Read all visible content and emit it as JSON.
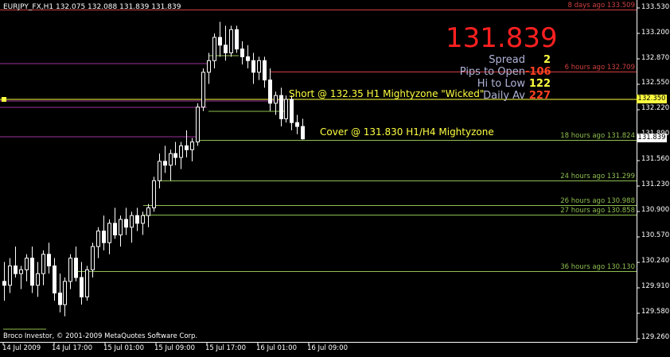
{
  "chart": {
    "symbol_header": "EURJPY_FX,H1  132.075 132.088 131.839 131.839",
    "big_price": "131.839",
    "copyright": "Broco Investor, © 2001-2009 MetaQuotes Software Corp.",
    "colors": {
      "background": "#000000",
      "candle": "#ffffff",
      "big_price": "#ff2020",
      "yellow": "#ffff40",
      "green_line": "#8fbf50",
      "red_line": "#d04040",
      "purple_line": "#a030a0"
    }
  },
  "stats": [
    {
      "label": "Spread",
      "value": "2",
      "color": "#ffff40"
    },
    {
      "label": "Pips to Open",
      "value": "-106",
      "color": "#ff4020"
    },
    {
      "label": "Hi to Low",
      "value": "122",
      "color": "#ffff40"
    },
    {
      "label": "Daily Av",
      "value": "227",
      "color": "#ff4020"
    }
  ],
  "annotations": {
    "short_text": "Short @ 132.35 H1 Mightyzone \"Wicked\"",
    "cover_text": "Cover @ 131.830 H1/H4 Mightyzone"
  },
  "y_axis": {
    "labels": [
      "133.530",
      "133.200",
      "132.870",
      "132.550",
      "132.220",
      "131.890",
      "131.560",
      "131.230",
      "130.900",
      "130.570",
      "130.240",
      "129.910",
      "129.580",
      "129.260"
    ]
  },
  "price_tags": [
    {
      "value": "132.350",
      "bg": "#ffff40",
      "color": "#000000"
    },
    {
      "value": "131.839",
      "bg": "#ffffff",
      "color": "#000000"
    }
  ],
  "x_axis": {
    "labels": [
      "14 Jul 2009",
      "14 Jul 17:00",
      "15 Jul 01:00",
      "15 Jul 09:00",
      "15 Jul 17:00",
      "16 Jul 01:00",
      "16 Jul 09:00"
    ]
  },
  "level_lines": [
    {
      "label": "8 days ago 133.509",
      "price": 133.509,
      "color": "#d04040"
    },
    {
      "label": "6 hours ago 132.709",
      "price": 132.709,
      "color": "#d04040"
    },
    {
      "label": "18 hours ago 131.824",
      "price": 131.824,
      "color": "#8fbf50"
    },
    {
      "label": "24 hours ago 131.299",
      "price": 131.299,
      "color": "#8fbf50"
    },
    {
      "label": "26 hours ago 130.988",
      "price": 130.988,
      "color": "#8fbf50"
    },
    {
      "label": "27 hours ago 130.858",
      "price": 130.858,
      "color": "#8fbf50"
    },
    {
      "label": "36 hours ago 130.130",
      "price": 130.13,
      "color": "#8fbf50"
    }
  ],
  "candles": [
    [
      130.0,
      130.25,
      129.75,
      129.95
    ],
    [
      129.95,
      130.3,
      129.85,
      130.2
    ],
    [
      130.2,
      130.45,
      130.05,
      130.1
    ],
    [
      130.1,
      130.2,
      129.9,
      130.15
    ],
    [
      130.15,
      130.35,
      130.0,
      130.3
    ],
    [
      130.3,
      130.45,
      129.85,
      129.95
    ],
    [
      129.95,
      130.25,
      129.8,
      130.1
    ],
    [
      130.1,
      130.4,
      129.95,
      130.35
    ],
    [
      130.35,
      130.5,
      130.1,
      130.2
    ],
    [
      130.2,
      130.3,
      129.75,
      129.85
    ],
    [
      129.85,
      130.1,
      129.6,
      129.7
    ],
    [
      129.7,
      130.05,
      129.55,
      130.0
    ],
    [
      130.0,
      130.35,
      129.9,
      130.3
    ],
    [
      130.3,
      130.45,
      130.0,
      130.05
    ],
    [
      130.05,
      130.25,
      129.7,
      129.8
    ],
    [
      129.8,
      130.2,
      129.75,
      130.15
    ],
    [
      130.15,
      130.5,
      130.05,
      130.45
    ],
    [
      130.45,
      130.7,
      130.3,
      130.65
    ],
    [
      130.65,
      130.85,
      130.4,
      130.5
    ],
    [
      130.5,
      130.8,
      130.35,
      130.75
    ],
    [
      130.75,
      130.95,
      130.55,
      130.6
    ],
    [
      130.6,
      130.85,
      130.45,
      130.8
    ],
    [
      130.8,
      130.95,
      130.6,
      130.7
    ],
    [
      130.7,
      130.9,
      130.5,
      130.85
    ],
    [
      130.85,
      130.95,
      130.65,
      130.75
    ],
    [
      130.75,
      130.9,
      130.6,
      130.85
    ],
    [
      130.85,
      131.0,
      130.7,
      130.95
    ],
    [
      130.95,
      131.35,
      130.9,
      131.3
    ],
    [
      131.3,
      131.65,
      131.2,
      131.55
    ],
    [
      131.55,
      131.75,
      131.4,
      131.5
    ],
    [
      131.5,
      131.7,
      131.3,
      131.65
    ],
    [
      131.65,
      131.8,
      131.5,
      131.6
    ],
    [
      131.6,
      131.8,
      131.45,
      131.75
    ],
    [
      131.75,
      131.95,
      131.6,
      131.7
    ],
    [
      131.7,
      131.85,
      131.55,
      131.8
    ],
    [
      131.8,
      132.3,
      131.75,
      132.25
    ],
    [
      132.25,
      132.75,
      132.2,
      132.7
    ],
    [
      132.7,
      132.95,
      132.55,
      132.85
    ],
    [
      132.85,
      133.2,
      132.75,
      133.15
    ],
    [
      133.15,
      133.35,
      132.9,
      133.05
    ],
    [
      133.05,
      133.3,
      132.85,
      132.95
    ],
    [
      132.95,
      133.3,
      132.9,
      133.25
    ],
    [
      133.25,
      133.3,
      132.95,
      133.0
    ],
    [
      133.0,
      133.1,
      132.8,
      132.9
    ],
    [
      132.9,
      133.05,
      132.75,
      132.85
    ],
    [
      132.85,
      132.95,
      132.55,
      132.7
    ],
    [
      132.7,
      132.9,
      132.6,
      132.85
    ],
    [
      132.85,
      132.9,
      132.5,
      132.6
    ],
    [
      132.6,
      132.75,
      132.2,
      132.3
    ],
    [
      132.3,
      132.45,
      132.15,
      132.4
    ],
    [
      132.4,
      132.5,
      132.0,
      132.1
    ],
    [
      132.1,
      132.4,
      132.05,
      132.35
    ],
    [
      132.35,
      132.4,
      131.95,
      132.05
    ],
    [
      132.05,
      132.15,
      131.9,
      132.0
    ],
    [
      132.0,
      132.1,
      131.83,
      131.84
    ]
  ]
}
